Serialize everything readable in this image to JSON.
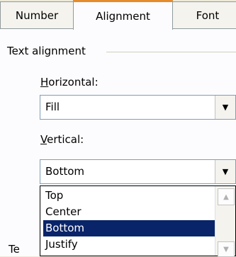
{
  "tabs": [
    {
      "label": "Number"
    },
    {
      "label": "Alignment"
    },
    {
      "label": "Font"
    }
  ],
  "group": {
    "title": "Text alignment"
  },
  "horizontal": {
    "label_prefix": "",
    "label_accel": "H",
    "label_rest": "orizontal:",
    "value": "Fill"
  },
  "vertical": {
    "label_accel": "V",
    "label_rest": "ertical:",
    "value": "Bottom",
    "options": [
      "Top",
      "Center",
      "Bottom",
      "Justify"
    ],
    "selected": "Bottom"
  },
  "partial_label": "Te"
}
